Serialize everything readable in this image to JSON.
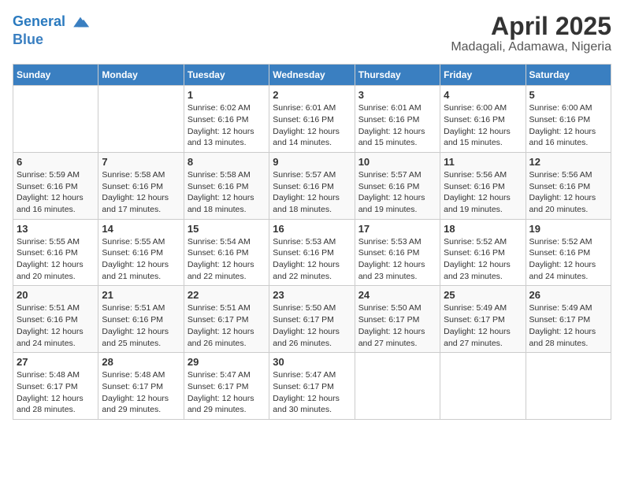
{
  "header": {
    "logo_line1": "General",
    "logo_line2": "Blue",
    "title": "April 2025",
    "subtitle": "Madagali, Adamawa, Nigeria"
  },
  "calendar": {
    "days_of_week": [
      "Sunday",
      "Monday",
      "Tuesday",
      "Wednesday",
      "Thursday",
      "Friday",
      "Saturday"
    ],
    "weeks": [
      [
        {
          "day": "",
          "info": ""
        },
        {
          "day": "",
          "info": ""
        },
        {
          "day": "1",
          "info": "Sunrise: 6:02 AM\nSunset: 6:16 PM\nDaylight: 12 hours\nand 13 minutes."
        },
        {
          "day": "2",
          "info": "Sunrise: 6:01 AM\nSunset: 6:16 PM\nDaylight: 12 hours\nand 14 minutes."
        },
        {
          "day": "3",
          "info": "Sunrise: 6:01 AM\nSunset: 6:16 PM\nDaylight: 12 hours\nand 15 minutes."
        },
        {
          "day": "4",
          "info": "Sunrise: 6:00 AM\nSunset: 6:16 PM\nDaylight: 12 hours\nand 15 minutes."
        },
        {
          "day": "5",
          "info": "Sunrise: 6:00 AM\nSunset: 6:16 PM\nDaylight: 12 hours\nand 16 minutes."
        }
      ],
      [
        {
          "day": "6",
          "info": "Sunrise: 5:59 AM\nSunset: 6:16 PM\nDaylight: 12 hours\nand 16 minutes."
        },
        {
          "day": "7",
          "info": "Sunrise: 5:58 AM\nSunset: 6:16 PM\nDaylight: 12 hours\nand 17 minutes."
        },
        {
          "day": "8",
          "info": "Sunrise: 5:58 AM\nSunset: 6:16 PM\nDaylight: 12 hours\nand 18 minutes."
        },
        {
          "day": "9",
          "info": "Sunrise: 5:57 AM\nSunset: 6:16 PM\nDaylight: 12 hours\nand 18 minutes."
        },
        {
          "day": "10",
          "info": "Sunrise: 5:57 AM\nSunset: 6:16 PM\nDaylight: 12 hours\nand 19 minutes."
        },
        {
          "day": "11",
          "info": "Sunrise: 5:56 AM\nSunset: 6:16 PM\nDaylight: 12 hours\nand 19 minutes."
        },
        {
          "day": "12",
          "info": "Sunrise: 5:56 AM\nSunset: 6:16 PM\nDaylight: 12 hours\nand 20 minutes."
        }
      ],
      [
        {
          "day": "13",
          "info": "Sunrise: 5:55 AM\nSunset: 6:16 PM\nDaylight: 12 hours\nand 20 minutes."
        },
        {
          "day": "14",
          "info": "Sunrise: 5:55 AM\nSunset: 6:16 PM\nDaylight: 12 hours\nand 21 minutes."
        },
        {
          "day": "15",
          "info": "Sunrise: 5:54 AM\nSunset: 6:16 PM\nDaylight: 12 hours\nand 22 minutes."
        },
        {
          "day": "16",
          "info": "Sunrise: 5:53 AM\nSunset: 6:16 PM\nDaylight: 12 hours\nand 22 minutes."
        },
        {
          "day": "17",
          "info": "Sunrise: 5:53 AM\nSunset: 6:16 PM\nDaylight: 12 hours\nand 23 minutes."
        },
        {
          "day": "18",
          "info": "Sunrise: 5:52 AM\nSunset: 6:16 PM\nDaylight: 12 hours\nand 23 minutes."
        },
        {
          "day": "19",
          "info": "Sunrise: 5:52 AM\nSunset: 6:16 PM\nDaylight: 12 hours\nand 24 minutes."
        }
      ],
      [
        {
          "day": "20",
          "info": "Sunrise: 5:51 AM\nSunset: 6:16 PM\nDaylight: 12 hours\nand 24 minutes."
        },
        {
          "day": "21",
          "info": "Sunrise: 5:51 AM\nSunset: 6:16 PM\nDaylight: 12 hours\nand 25 minutes."
        },
        {
          "day": "22",
          "info": "Sunrise: 5:51 AM\nSunset: 6:17 PM\nDaylight: 12 hours\nand 26 minutes."
        },
        {
          "day": "23",
          "info": "Sunrise: 5:50 AM\nSunset: 6:17 PM\nDaylight: 12 hours\nand 26 minutes."
        },
        {
          "day": "24",
          "info": "Sunrise: 5:50 AM\nSunset: 6:17 PM\nDaylight: 12 hours\nand 27 minutes."
        },
        {
          "day": "25",
          "info": "Sunrise: 5:49 AM\nSunset: 6:17 PM\nDaylight: 12 hours\nand 27 minutes."
        },
        {
          "day": "26",
          "info": "Sunrise: 5:49 AM\nSunset: 6:17 PM\nDaylight: 12 hours\nand 28 minutes."
        }
      ],
      [
        {
          "day": "27",
          "info": "Sunrise: 5:48 AM\nSunset: 6:17 PM\nDaylight: 12 hours\nand 28 minutes."
        },
        {
          "day": "28",
          "info": "Sunrise: 5:48 AM\nSunset: 6:17 PM\nDaylight: 12 hours\nand 29 minutes."
        },
        {
          "day": "29",
          "info": "Sunrise: 5:47 AM\nSunset: 6:17 PM\nDaylight: 12 hours\nand 29 minutes."
        },
        {
          "day": "30",
          "info": "Sunrise: 5:47 AM\nSunset: 6:17 PM\nDaylight: 12 hours\nand 30 minutes."
        },
        {
          "day": "",
          "info": ""
        },
        {
          "day": "",
          "info": ""
        },
        {
          "day": "",
          "info": ""
        }
      ]
    ]
  }
}
